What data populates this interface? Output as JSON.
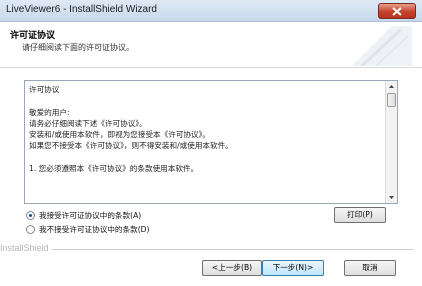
{
  "window": {
    "title": "LiveViewer6 - InstallShield Wizard"
  },
  "header": {
    "title": "许可证协议",
    "subtitle": "请仔细阅读下面的许可证协议。"
  },
  "license": {
    "heading": "许可协议",
    "lines": [
      "敬爱的用户:",
      "请务必仔细阅读下述《许可协议》。",
      "安装和/或使用本软件，即视为您接受本《许可协议》。",
      "如果您不接受本《许可协议》，则不得安装和/或使用本软件。",
      "1. 您必须遵照本《许可协议》的条款使用本软件。"
    ]
  },
  "options": {
    "accept_label": "我接受许可证协议中的条款(A)",
    "decline_label": "我不接受许可证协议中的条款(D)",
    "selected": "accept"
  },
  "buttons": {
    "print": "打印(P)",
    "back": "<上一步(B)",
    "next": "下一步(N)>",
    "cancel": "取消"
  },
  "footer": {
    "brand": "InstallShield"
  },
  "colors": {
    "close_button": "#c5412a",
    "next_button_border": "#3c7fb1"
  }
}
